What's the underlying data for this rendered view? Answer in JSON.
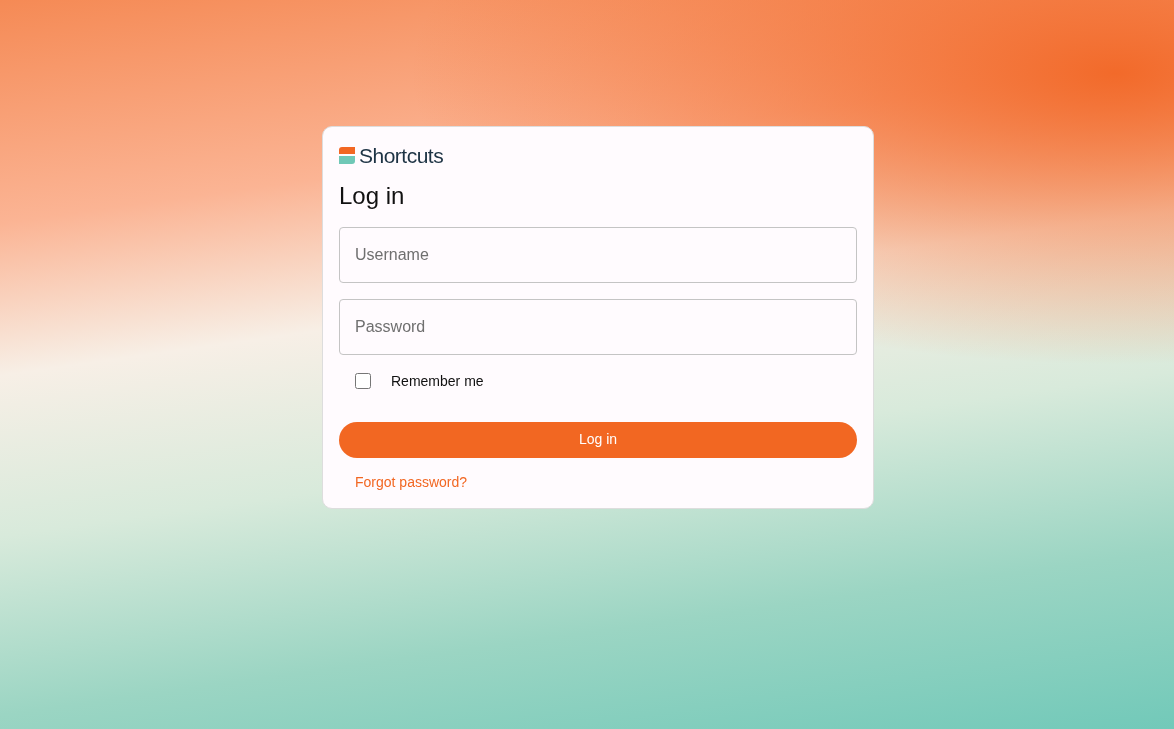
{
  "logo": {
    "text": "Shortcuts"
  },
  "title": "Log in",
  "fields": [
    {
      "placeholder": "Username"
    },
    {
      "placeholder": "Password"
    }
  ],
  "remember": {
    "label": "Remember me",
    "checked": false
  },
  "submit": "Log in",
  "forgot_link": "Forgot password?"
}
